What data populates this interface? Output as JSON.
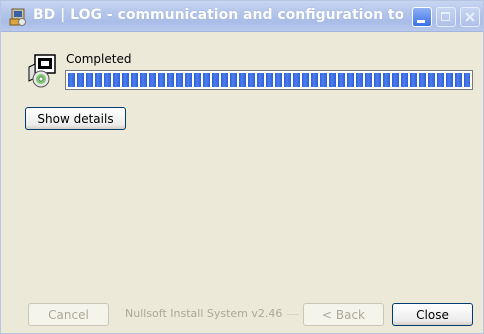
{
  "window": {
    "title": "BD | LOG - communication and configuration tool ..."
  },
  "status": {
    "label": "Completed",
    "progress_percent": 100
  },
  "buttons": {
    "show_details": "Show details",
    "cancel": "Cancel",
    "back": "< Back",
    "close": "Close"
  },
  "branding": "Nullsoft Install System v2.46",
  "colors": {
    "dialog_bg": "#ece9d8",
    "progress_blue": "#2f5fd7",
    "titlebar_inactive": "#b3c5ea"
  },
  "icons": {
    "app": "installer-app-icon",
    "install": "software-install-disk-icon"
  }
}
